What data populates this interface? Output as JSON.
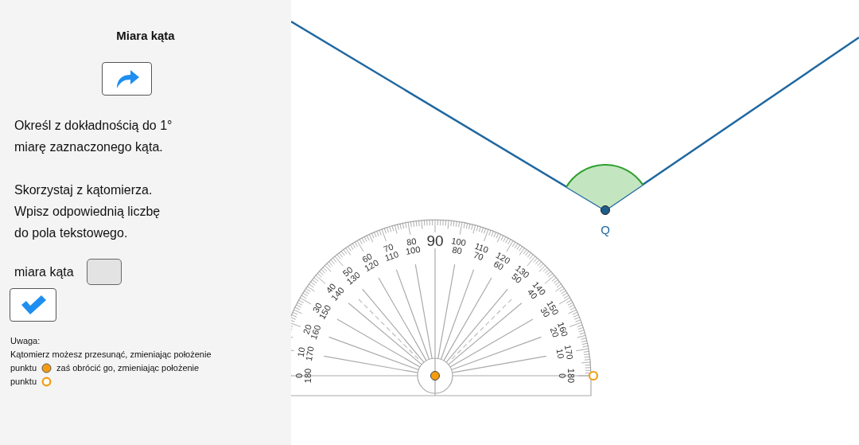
{
  "panel": {
    "title": "Miara kąta",
    "instructions": [
      [
        "Określ z dokładnością do 1°",
        "miarę zaznaczonego kąta."
      ],
      [
        "Skorzystaj z kątomierza.",
        "Wpisz odpowiednią liczbę",
        "do pola tekstowego."
      ]
    ],
    "answer": {
      "label": "miara kąta"
    },
    "note": {
      "heading": "Uwaga:",
      "lines": [
        [
          {
            "kind": "text",
            "text": "Kątomierz możesz przesunąć, zmieniając położenie"
          }
        ],
        [
          {
            "kind": "text",
            "text": "punktu"
          },
          {
            "kind": "filled-point"
          },
          {
            "kind": "text",
            "text": "zaś obrócić go, zmieniając położenie"
          }
        ],
        [
          {
            "kind": "text",
            "text": "punktu"
          },
          {
            "kind": "hollow-point"
          }
        ]
      ]
    }
  },
  "canvas": {
    "vertex": {
      "label": "Q"
    },
    "protractor": {
      "scale": [
        {
          "outer": "0",
          "inner": "180"
        },
        {
          "outer": "10",
          "inner": "170"
        },
        {
          "outer": "20",
          "inner": "160"
        },
        {
          "outer": "30",
          "inner": "150"
        },
        {
          "outer": "40",
          "inner": "140"
        },
        {
          "outer": "50",
          "inner": "130"
        },
        {
          "outer": "60",
          "inner": "120"
        },
        {
          "outer": "70",
          "inner": "110"
        },
        {
          "outer": "80",
          "inner": "100"
        },
        {
          "outer": "90"
        },
        {
          "outer": "100",
          "inner": "80"
        },
        {
          "outer": "110",
          "inner": "70"
        },
        {
          "outer": "120",
          "inner": "60"
        },
        {
          "outer": "130",
          "inner": "50"
        },
        {
          "outer": "140",
          "inner": "40"
        },
        {
          "outer": "150",
          "inner": "30"
        },
        {
          "outer": "160",
          "inner": "20"
        },
        {
          "outer": "170",
          "inner": "10"
        },
        {
          "outer": "180",
          "inner": "0"
        }
      ]
    }
  }
}
